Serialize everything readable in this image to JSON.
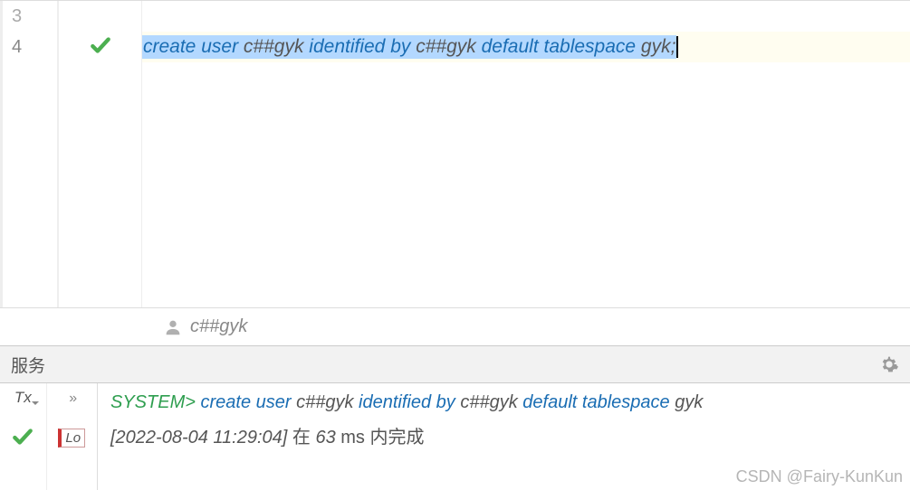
{
  "editor": {
    "lines": {
      "3": {
        "num": "3"
      },
      "4": {
        "num": "4",
        "tokens": {
          "t1": "create",
          "t2": " ",
          "t3": "user",
          "t4": " c##gyk ",
          "t5": "identified",
          "t6": " ",
          "t7": "by",
          "t8": " c##gyk ",
          "t9": "default",
          "t10": " ",
          "t11": "tablespace",
          "t12": " gyk;"
        }
      }
    }
  },
  "userbar": {
    "name": "c##gyk"
  },
  "services": {
    "title": "服务"
  },
  "console": {
    "tx": "Tx",
    "lo": "Lo",
    "line1": {
      "prompt": "SYSTEM>",
      "t1": " create",
      "t2": " ",
      "t3": "user",
      "t4": " c##gyk ",
      "t5": "identified",
      "t6": " ",
      "t7": "by",
      "t8": " c##gyk ",
      "t9": "default",
      "t10": " ",
      "t11": "tablespace",
      "t12": " gyk"
    },
    "line2": {
      "ts": "[2022-08-04 11:29:04] ",
      "pre": "在 ",
      "ms": "63",
      "post": " ms 内完成"
    }
  },
  "watermark": "CSDN @Fairy-KunKun"
}
